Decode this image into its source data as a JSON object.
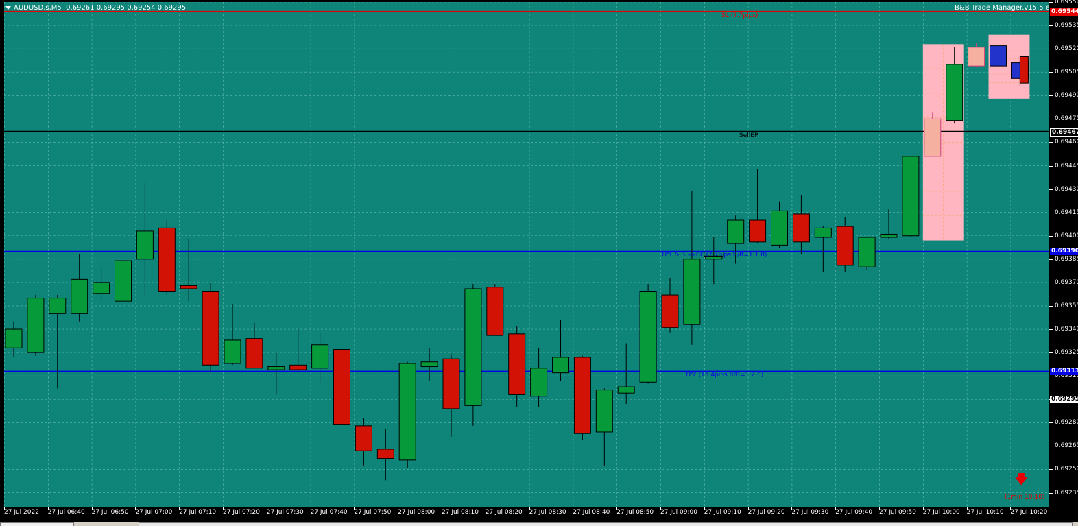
{
  "symbol": {
    "name": "AUDUSD.s,M5",
    "ohlc": "0.69261 0.69295 0.69254 0.69295"
  },
  "ea_label": "B&B Trade Manager.v15.5 exec",
  "colors": {
    "background": "#0f857a",
    "bull": "#079a3a",
    "bear": "#d21205",
    "sl_line": "#e60000",
    "entry_line": "#000000",
    "tp_line": "#0000e6",
    "zone": "#ffb6c1",
    "grid": "#7fd4c8"
  },
  "price_axis": {
    "top_price": 0.6955,
    "bottom_price": 0.69226,
    "ticks": [
      "0.69550",
      "0.69535",
      "0.69520",
      "0.69505",
      "0.69490",
      "0.69475",
      "0.69460",
      "0.69445",
      "0.69430",
      "0.69415",
      "0.69400",
      "0.69385",
      "0.69370",
      "0.69355",
      "0.69340",
      "0.69325",
      "0.69310",
      "0.69295",
      "0.69280",
      "0.69265",
      "0.69250",
      "0.69235"
    ]
  },
  "time_axis": {
    "labels": [
      "27 Jul 2022",
      "27 Jul 06:40",
      "27 Jul 06:50",
      "27 Jul 07:00",
      "27 Jul 07:10",
      "27 Jul 07:20",
      "27 Jul 07:30",
      "27 Jul 07:40",
      "27 Jul 07:50",
      "27 Jul 08:00",
      "27 Jul 08:10",
      "27 Jul 08:20",
      "27 Jul 08:30",
      "27 Jul 08:40",
      "27 Jul 08:50",
      "27 Jul 09:00",
      "27 Jul 09:10",
      "27 Jul 09:20",
      "27 Jul 09:30",
      "27 Jul 09:40",
      "27 Jul 09:50",
      "27 Jul 10:00",
      "27 Jul 10:10",
      "27 Jul 10:20"
    ]
  },
  "lines": {
    "sl": {
      "price": 0.69544,
      "tag": "0.69544",
      "label": "SL (7.7pips)"
    },
    "entry": {
      "price": 0.69467,
      "tag": "0.69467",
      "label": "SellEP"
    },
    "tp1": {
      "price": 0.6939,
      "tag": "0.69390",
      "label": "TP1 & SL->BE (7.7pips R/R=1:1.0)"
    },
    "tp2": {
      "price": 0.69313,
      "tag": "0.69313",
      "label": "TP2 (15.4pips R/R=1:2.0)"
    },
    "current": {
      "price": 0.69295,
      "tag": "0.69295"
    }
  },
  "countdown": "(1min 10:10)",
  "zones": [
    {
      "from_index": 42,
      "to_index": 43,
      "high": 0.69523,
      "low": 0.69397
    },
    {
      "from_index": 45,
      "to_index": 46,
      "high": 0.69529,
      "low": 0.69488
    }
  ],
  "chart_data": {
    "type": "candlestick",
    "xlabel": "",
    "ylabel": "",
    "ylim": [
      0.69226,
      0.6955
    ],
    "candles": [
      {
        "o": 0.69328,
        "h": 0.69345,
        "l": 0.69322,
        "c": 0.6934
      },
      {
        "o": 0.69325,
        "h": 0.69362,
        "l": 0.69323,
        "c": 0.6936
      },
      {
        "o": 0.6935,
        "h": 0.69362,
        "l": 0.69302,
        "c": 0.6936
      },
      {
        "o": 0.6935,
        "h": 0.69388,
        "l": 0.69345,
        "c": 0.69372
      },
      {
        "o": 0.69363,
        "h": 0.6938,
        "l": 0.69358,
        "c": 0.6937
      },
      {
        "o": 0.69358,
        "h": 0.69403,
        "l": 0.69355,
        "c": 0.69384
      },
      {
        "o": 0.69385,
        "h": 0.69434,
        "l": 0.69362,
        "c": 0.69403
      },
      {
        "o": 0.69405,
        "h": 0.6941,
        "l": 0.69362,
        "c": 0.69364
      },
      {
        "o": 0.69368,
        "h": 0.69398,
        "l": 0.69358,
        "c": 0.69366
      },
      {
        "o": 0.69364,
        "h": 0.6937,
        "l": 0.69313,
        "c": 0.69317
      },
      {
        "o": 0.69318,
        "h": 0.69356,
        "l": 0.69317,
        "c": 0.69333
      },
      {
        "o": 0.69334,
        "h": 0.69344,
        "l": 0.69316,
        "c": 0.69315
      },
      {
        "o": 0.69314,
        "h": 0.69325,
        "l": 0.69298,
        "c": 0.69316
      },
      {
        "o": 0.69317,
        "h": 0.6934,
        "l": 0.69312,
        "c": 0.69314
      },
      {
        "o": 0.69315,
        "h": 0.69338,
        "l": 0.69306,
        "c": 0.6933
      },
      {
        "o": 0.69327,
        "h": 0.69338,
        "l": 0.69275,
        "c": 0.69279
      },
      {
        "o": 0.69278,
        "h": 0.69283,
        "l": 0.69252,
        "c": 0.69262
      },
      {
        "o": 0.69263,
        "h": 0.69276,
        "l": 0.69243,
        "c": 0.69257
      },
      {
        "o": 0.69256,
        "h": 0.69319,
        "l": 0.69251,
        "c": 0.69318
      },
      {
        "o": 0.69316,
        "h": 0.69328,
        "l": 0.69307,
        "c": 0.69319
      },
      {
        "o": 0.69321,
        "h": 0.69324,
        "l": 0.69271,
        "c": 0.69289
      },
      {
        "o": 0.69291,
        "h": 0.69369,
        "l": 0.69278,
        "c": 0.69366
      },
      {
        "o": 0.69367,
        "h": 0.69369,
        "l": 0.69336,
        "c": 0.69336
      },
      {
        "o": 0.69337,
        "h": 0.69342,
        "l": 0.6929,
        "c": 0.69298
      },
      {
        "o": 0.69297,
        "h": 0.69328,
        "l": 0.6929,
        "c": 0.69315
      },
      {
        "o": 0.69312,
        "h": 0.69346,
        "l": 0.69307,
        "c": 0.69322
      },
      {
        "o": 0.69322,
        "h": 0.69323,
        "l": 0.69269,
        "c": 0.69273
      },
      {
        "o": 0.69274,
        "h": 0.69302,
        "l": 0.69252,
        "c": 0.69301
      },
      {
        "o": 0.69299,
        "h": 0.69331,
        "l": 0.69292,
        "c": 0.69303
      },
      {
        "o": 0.69306,
        "h": 0.69369,
        "l": 0.69305,
        "c": 0.69364
      },
      {
        "o": 0.69362,
        "h": 0.69373,
        "l": 0.69338,
        "c": 0.69341
      },
      {
        "o": 0.69343,
        "h": 0.69429,
        "l": 0.6933,
        "c": 0.69385
      },
      {
        "o": 0.69385,
        "h": 0.69399,
        "l": 0.69369,
        "c": 0.69387
      },
      {
        "o": 0.69395,
        "h": 0.69413,
        "l": 0.69382,
        "c": 0.6941
      },
      {
        "o": 0.6941,
        "h": 0.69443,
        "l": 0.69395,
        "c": 0.69396
      },
      {
        "o": 0.69394,
        "h": 0.69422,
        "l": 0.69392,
        "c": 0.69416
      },
      {
        "o": 0.69414,
        "h": 0.69426,
        "l": 0.69388,
        "c": 0.69396
      },
      {
        "o": 0.69399,
        "h": 0.69406,
        "l": 0.69377,
        "c": 0.69405
      },
      {
        "o": 0.69406,
        "h": 0.69412,
        "l": 0.69377,
        "c": 0.69381
      },
      {
        "o": 0.6938,
        "h": 0.69398,
        "l": 0.69378,
        "c": 0.69399
      },
      {
        "o": 0.69399,
        "h": 0.69417,
        "l": 0.69398,
        "c": 0.69401
      },
      {
        "o": 0.694,
        "h": 0.69451,
        "l": 0.69399,
        "c": 0.69451
      },
      {
        "o": 0.69451,
        "h": 0.69479,
        "l": 0.69452,
        "c": 0.69475
      },
      {
        "o": 0.69474,
        "h": 0.69521,
        "l": 0.69472,
        "c": 0.6951
      },
      {
        "o": 0.69509,
        "h": 0.69524,
        "l": 0.69508,
        "c": 0.69521
      },
      {
        "o": 0.69522,
        "h": 0.6953,
        "l": 0.69496,
        "c": 0.69509
      },
      {
        "o": 0.69511,
        "h": 0.69512,
        "l": 0.69496,
        "c": 0.69501
      }
    ]
  }
}
